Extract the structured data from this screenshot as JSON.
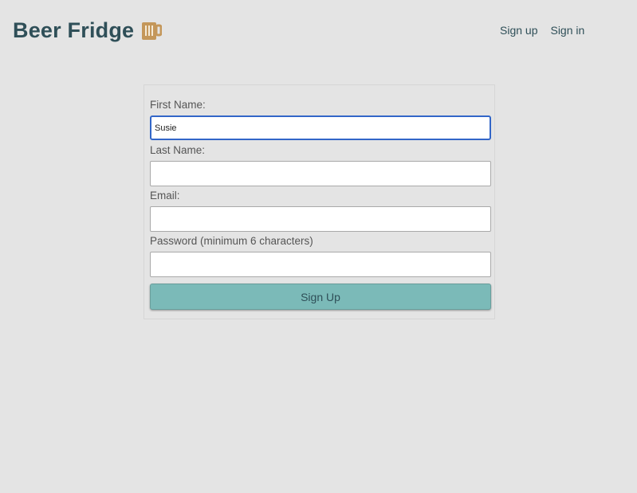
{
  "header": {
    "title": "Beer Fridge",
    "logo_icon": "beer-mug-icon",
    "logo_color": "#c4975a"
  },
  "nav": {
    "sign_up": "Sign up",
    "sign_in": "Sign in"
  },
  "form": {
    "first_name": {
      "label": "First Name:",
      "value": "Susie",
      "focused": true
    },
    "last_name": {
      "label": "Last Name:",
      "value": ""
    },
    "email": {
      "label": "Email:",
      "value": ""
    },
    "password": {
      "label": "Password (minimum 6 characters)",
      "value": ""
    },
    "submit_label": "Sign Up"
  },
  "colors": {
    "background": "#e4e4e4",
    "brand_text": "#2f4f58",
    "button": "#7bbab8",
    "focus_border": "#3266c8"
  }
}
